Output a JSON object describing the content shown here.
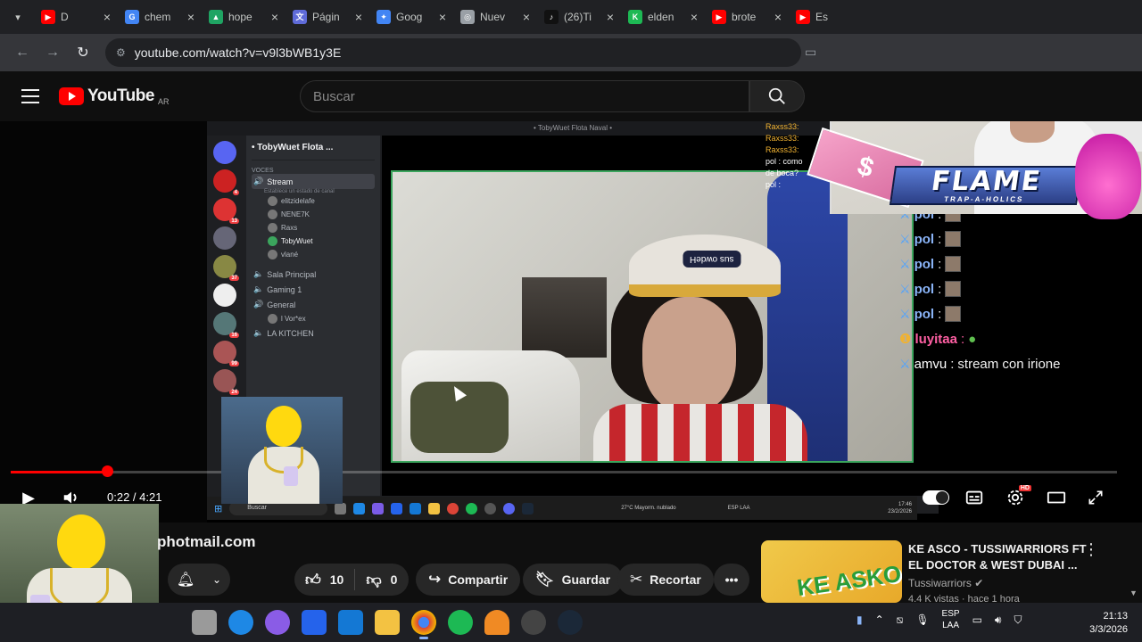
{
  "browser": {
    "tabs": [
      {
        "label": "D",
        "color": "#ff0000"
      },
      {
        "label": "chem",
        "color": "#4285f4"
      },
      {
        "label": "hope",
        "color": "#1fa463"
      },
      {
        "label": "Págin",
        "color": "#5f6bd8"
      },
      {
        "label": "Goog",
        "color": "#4285f4"
      },
      {
        "label": "Nuev",
        "color": "#9aa0a6"
      },
      {
        "label": "(26)Ti",
        "color": "#111111"
      },
      {
        "label": "elden",
        "color": "#1db954"
      },
      {
        "label": "brote",
        "color": "#ff0000"
      },
      {
        "label": "Es",
        "color": "#ff0000"
      }
    ],
    "url": "youtube.com/watch?v=v9l3bWB1y3E"
  },
  "youtube": {
    "logo_text": "YouTube",
    "region": "AR",
    "search_placeholder": "Buscar"
  },
  "video": {
    "discord": {
      "window_title": "• TobyWuet Flota Naval •",
      "server_name": "• TobyWuet Flota ...",
      "voice_category": "VOCES",
      "channels": [
        {
          "name": "Stream",
          "selected": true,
          "status": "Establece un estado de canal"
        },
        {
          "name": "Sala Principal"
        },
        {
          "name": "Gaming 1"
        },
        {
          "name": "General"
        },
        {
          "name": "LA KITCHEN"
        }
      ],
      "users": [
        "elitzidelafe",
        "NENE7K",
        "Raxs",
        "TobyWuet",
        "vlané"
      ],
      "general_user": "l Vor*ex",
      "guild_badges": [
        "4",
        "13",
        "37",
        "16",
        "99",
        "24"
      ]
    },
    "taskbar": {
      "search": "Buscar",
      "weather": "27°C Mayorm. nublado",
      "lang": "ESP LAA",
      "time": "17:46",
      "date": "23/2/2026"
    },
    "chat_top": [
      "Raxss33:",
      "Raxss33:",
      "Raxss33:",
      "pol : como",
      "de boca?",
      "pol :"
    ],
    "chat": [
      {
        "user": "pol",
        "text": ""
      },
      {
        "user": "pol",
        "text": ""
      },
      {
        "user": "pol",
        "text": ""
      },
      {
        "user": "pol",
        "text": ""
      },
      {
        "user": "pol",
        "text": ""
      },
      {
        "user": "luyitaa",
        "text": ""
      },
      {
        "user": "amvu",
        "text": "stream con irione"
      }
    ],
    "overlay": {
      "flame_title": "FLAME",
      "flame_sub": "TRAP-A-HOLICS",
      "dollar_value": "$",
      "cap_text": "sus owdeH"
    },
    "time_current": "0:22",
    "time_total": "4:21",
    "time_display": "0:22 / 4:21",
    "progress_percent": 8.7
  },
  "below": {
    "channel_handle": "photmail.com",
    "likes": "10",
    "dislikes": "0",
    "share": "Compartir",
    "save": "Guardar",
    "clip": "Recortar"
  },
  "recommended": {
    "title": "KE ASCO - TUSSIWARRIORS FT EL DOCTOR & WEST DUBAI ...",
    "channel": "Tussiwarriors",
    "meta": "4.4 K vistas · hace 1 hora",
    "thumb_text": "KE ASKO"
  },
  "taskbar": {
    "lang": "ESP",
    "lang2": "LAA",
    "time": "21:13",
    "date": "3/3/2026"
  },
  "colors": {
    "youtube_red": "#ff0000",
    "background": "#0f0f0f",
    "discord_green": "#3ba55d"
  }
}
